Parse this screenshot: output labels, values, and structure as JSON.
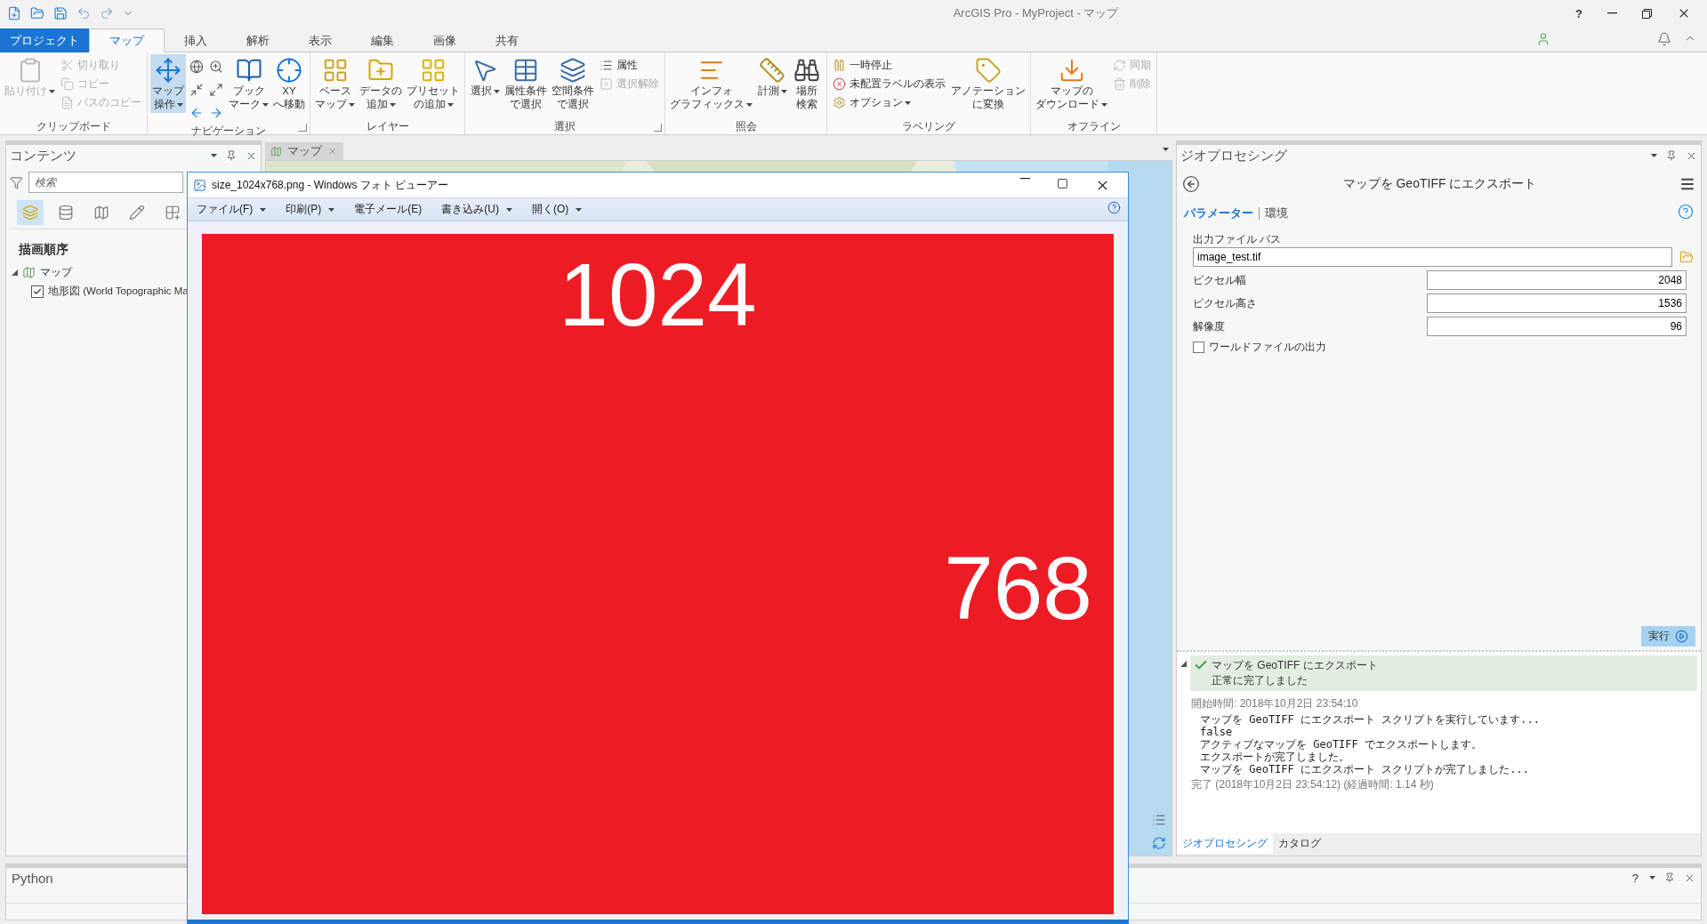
{
  "title_bar": {
    "title": "ArcGIS Pro - MyProject - マップ",
    "help": "?"
  },
  "ribbon_tabs": [
    {
      "label": "プロジェクト",
      "kind": "backstage",
      "selected": false
    },
    {
      "label": "マップ",
      "kind": "tab",
      "selected": true
    },
    {
      "label": "挿入",
      "kind": "tab",
      "selected": false
    },
    {
      "label": "解析",
      "kind": "tab",
      "selected": false
    },
    {
      "label": "表示",
      "kind": "tab",
      "selected": false
    },
    {
      "label": "編集",
      "kind": "tab",
      "selected": false
    },
    {
      "label": "画像",
      "kind": "tab",
      "selected": false
    },
    {
      "label": "共有",
      "kind": "tab",
      "selected": false
    }
  ],
  "ribbon_groups": [
    {
      "label": "クリップボード",
      "launcher": false,
      "buttons": [
        {
          "kind": "large",
          "lines": [
            "貼り付け"
          ],
          "dropdown": true,
          "disabled": true,
          "selected": false
        },
        {
          "kind": "small",
          "lines": [
            "切り取り"
          ],
          "dropdown": false,
          "disabled": true,
          "selected": false
        },
        {
          "kind": "small",
          "lines": [
            "コピー"
          ],
          "dropdown": false,
          "disabled": true,
          "selected": false
        },
        {
          "kind": "small",
          "lines": [
            "パスのコピー"
          ],
          "dropdown": false,
          "disabled": true,
          "selected": false
        }
      ]
    },
    {
      "label": "ナビゲーション",
      "launcher": true,
      "buttons": [
        {
          "kind": "large",
          "lines": [
            "マップ",
            "操作"
          ],
          "dropdown": true,
          "disabled": false,
          "selected": true
        },
        {
          "kind": "icons",
          "disabled": false,
          "selected": false
        },
        {
          "kind": "large",
          "lines": [
            "ブック",
            "マーク"
          ],
          "dropdown": true,
          "disabled": false,
          "selected": false
        },
        {
          "kind": "large",
          "lines": [
            "XY",
            "へ移動"
          ],
          "dropdown": false,
          "disabled": false,
          "selected": false
        }
      ]
    },
    {
      "label": "レイヤー",
      "launcher": false,
      "buttons": [
        {
          "kind": "large",
          "lines": [
            "ベース",
            "マップ"
          ],
          "dropdown": true,
          "disabled": false,
          "selected": false
        },
        {
          "kind": "large",
          "lines": [
            "データの",
            "追加"
          ],
          "dropdown": true,
          "disabled": false,
          "selected": false
        },
        {
          "kind": "large",
          "lines": [
            "プリセット",
            "の追加"
          ],
          "dropdown": true,
          "disabled": false,
          "selected": false
        }
      ]
    },
    {
      "label": "選択",
      "launcher": true,
      "buttons": [
        {
          "kind": "large",
          "lines": [
            "選択"
          ],
          "dropdown": true,
          "disabled": false,
          "selected": false
        },
        {
          "kind": "large",
          "lines": [
            "属性条件",
            "で選択"
          ],
          "dropdown": false,
          "disabled": false,
          "selected": false
        },
        {
          "kind": "large",
          "lines": [
            "空間条件",
            "で選択"
          ],
          "dropdown": false,
          "disabled": false,
          "selected": false
        },
        {
          "kind": "small",
          "lines": [
            "属性"
          ],
          "dropdown": false,
          "disabled": false,
          "selected": false
        },
        {
          "kind": "small",
          "lines": [
            "選択解除"
          ],
          "dropdown": false,
          "disabled": true,
          "selected": false
        }
      ]
    },
    {
      "label": "照会",
      "launcher": false,
      "buttons": [
        {
          "kind": "large",
          "lines": [
            "インフォ",
            "グラフィックス"
          ],
          "dropdown": true,
          "disabled": false,
          "selected": false
        },
        {
          "kind": "large",
          "lines": [
            "計測"
          ],
          "dropdown": true,
          "disabled": false,
          "selected": false
        },
        {
          "kind": "large",
          "lines": [
            "場所",
            "検索"
          ],
          "dropdown": false,
          "disabled": false,
          "selected": false
        }
      ]
    },
    {
      "label": "ラベリング",
      "launcher": false,
      "buttons": [
        {
          "kind": "small",
          "lines": [
            "一時停止"
          ],
          "dropdown": false,
          "disabled": false,
          "selected": false
        },
        {
          "kind": "small",
          "lines": [
            "未配置ラベルの表示"
          ],
          "dropdown": false,
          "disabled": false,
          "selected": false
        },
        {
          "kind": "small",
          "lines": [
            "オプション"
          ],
          "dropdown": true,
          "disabled": false,
          "selected": false
        },
        {
          "kind": "large",
          "lines": [
            "アノテーション",
            "に変換"
          ],
          "dropdown": false,
          "disabled": false,
          "selected": false
        }
      ]
    },
    {
      "label": "オフライン",
      "launcher": false,
      "buttons": [
        {
          "kind": "large",
          "lines": [
            "マップの",
            "ダウンロード"
          ],
          "dropdown": true,
          "disabled": false,
          "selected": false
        },
        {
          "kind": "small",
          "lines": [
            "同期"
          ],
          "dropdown": false,
          "disabled": true,
          "selected": false
        },
        {
          "kind": "small",
          "lines": [
            "削除"
          ],
          "dropdown": false,
          "disabled": true,
          "selected": false
        }
      ]
    }
  ],
  "contents_pane": {
    "title": "コンテンツ",
    "search": {
      "placeholder": "検索"
    },
    "view_buttons": [
      {
        "selected": true
      },
      {
        "selected": false
      },
      {
        "selected": false
      },
      {
        "selected": false
      },
      {
        "selected": false
      }
    ],
    "heading": "描画順序",
    "tree": [
      {
        "label": "マップ",
        "expanded": true,
        "children": [
          {
            "label": "地形図 (World Topographic Ma",
            "checked": true
          }
        ]
      }
    ]
  },
  "map_pane": {
    "tab": "マップ"
  },
  "photo_viewer": {
    "title": "size_1024x768.png - Windows フォト ビューアー",
    "menu": [
      {
        "label": "ファイル(F)",
        "dropdown": true
      },
      {
        "label": "印刷(P)",
        "dropdown": true
      },
      {
        "label": "電子メール(E)",
        "dropdown": false
      },
      {
        "label": "書き込み(U)",
        "dropdown": true
      },
      {
        "label": "開く(O)",
        "dropdown": true
      }
    ],
    "image": {
      "numbers": [
        "1024",
        "768"
      ]
    }
  },
  "geoprocessing_pane": {
    "title": "ジオプロセシング",
    "tool_title": "マップを GeoTIFF にエクスポート",
    "tabs": [
      {
        "label": "パラメーター",
        "selected": true
      },
      {
        "label": "環境",
        "selected": false
      }
    ],
    "parameters": [
      {
        "kind": "path",
        "label": "出力ファイル パス",
        "value": "image_test.tif"
      },
      {
        "kind": "number",
        "label": "ピクセル幅",
        "value": "2048"
      },
      {
        "kind": "number",
        "label": "ピクセル高さ",
        "value": "1536"
      },
      {
        "kind": "number",
        "label": "解像度",
        "value": "96"
      },
      {
        "kind": "checkbox",
        "label": "ワールドファイルの出力",
        "checked": false
      }
    ],
    "run_button": "実行",
    "message": {
      "expanded": true,
      "title": "マップを GeoTIFF にエクスポート",
      "status": "正常に完了しました",
      "start": "開始時間: 2018年10月2日 23:54:10",
      "log": [
        "マップを GeoTIFF にエクスポート スクリプトを実行しています...",
        "false",
        "アクティブなマップを GeoTIFF でエクスポートします。",
        "エクスポートが完了しました。",
        "マップを GeoTIFF にエクスポート スクリプトが完了しました..."
      ],
      "end": "完了 (2018年10月2日 23:54:12) (経過時間: 1.14 秒)"
    },
    "bottom_tabs": [
      {
        "label": "ジオプロセシング",
        "selected": true
      },
      {
        "label": "カタログ",
        "selected": false
      }
    ]
  },
  "python_pane": {
    "title": "Python",
    "help": "?"
  }
}
